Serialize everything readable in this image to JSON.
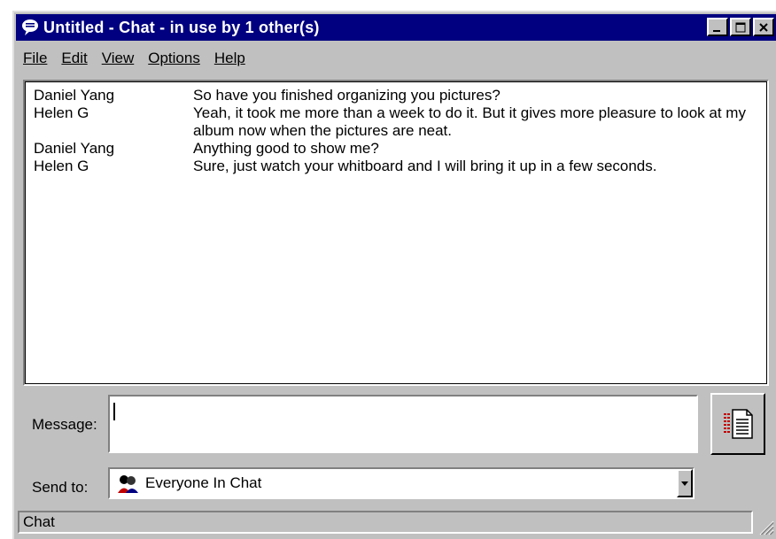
{
  "window": {
    "title": "Untitled - Chat - in use by 1 other(s)"
  },
  "menu": [
    {
      "label": "File"
    },
    {
      "label": "Edit"
    },
    {
      "label": "View"
    },
    {
      "label": "Options"
    },
    {
      "label": "Help"
    }
  ],
  "chat": {
    "messages": [
      {
        "sender": "Daniel Yang",
        "text": "So have you finished organizing you pictures?"
      },
      {
        "sender": "Helen G",
        "text": "Yeah, it took me more than a week to do it.  But it gives more pleasure to look at my album now when the pictures are neat."
      },
      {
        "sender": "Daniel Yang",
        "text": "Anything good to show me?"
      },
      {
        "sender": "Helen G",
        "text": "Sure, just watch your whitboard and I will bring it up in a few seconds."
      }
    ]
  },
  "compose": {
    "message_label": "Message:",
    "message_value": "",
    "sendto_label": "Send to:",
    "sendto_value": "Everyone In Chat"
  },
  "status": {
    "text": "Chat"
  },
  "icons": {
    "title": "chat-bubble-icon",
    "send": "send-message-icon",
    "sendto": "group-users-icon",
    "dropdown": "dropdown-arrow-icon"
  },
  "colors": {
    "titlebar": "#000080",
    "face": "#c0c0c0"
  }
}
